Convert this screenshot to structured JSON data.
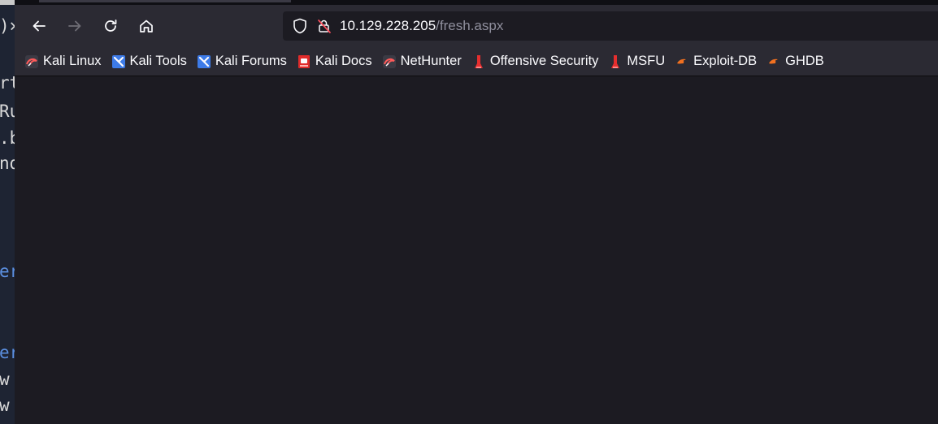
{
  "terminal": {
    "lines": [
      ")×",
      "rt",
      "Ru",
      ".b",
      "nd",
      "er",
      "er",
      " w",
      " w"
    ]
  },
  "navigation": {
    "back_icon": "arrow-left-icon",
    "forward_icon": "arrow-right-icon",
    "reload_icon": "reload-icon",
    "home_icon": "home-icon"
  },
  "urlbar": {
    "host": "10.129.228.205",
    "path": "/fresh.aspx"
  },
  "bookmarks": [
    {
      "label": "Kali Linux",
      "icon": "kali-dragon-icon"
    },
    {
      "label": "Kali Tools",
      "icon": "kali-tools-icon"
    },
    {
      "label": "Kali Forums",
      "icon": "kali-forums-icon"
    },
    {
      "label": "Kali Docs",
      "icon": "kali-docs-icon"
    },
    {
      "label": "NetHunter",
      "icon": "nethunter-icon"
    },
    {
      "label": "Offensive Security",
      "icon": "offsec-icon"
    },
    {
      "label": "MSFU",
      "icon": "msfu-icon"
    },
    {
      "label": "Exploit-DB",
      "icon": "exploit-db-icon"
    },
    {
      "label": "GHDB",
      "icon": "ghdb-icon"
    }
  ],
  "colors": {
    "toolbar": "#2b2a33",
    "content": "#1c1b22",
    "text": "#fbfbfe",
    "url_path": "#8f8f9d",
    "terminal_bg": "#1e2433"
  }
}
